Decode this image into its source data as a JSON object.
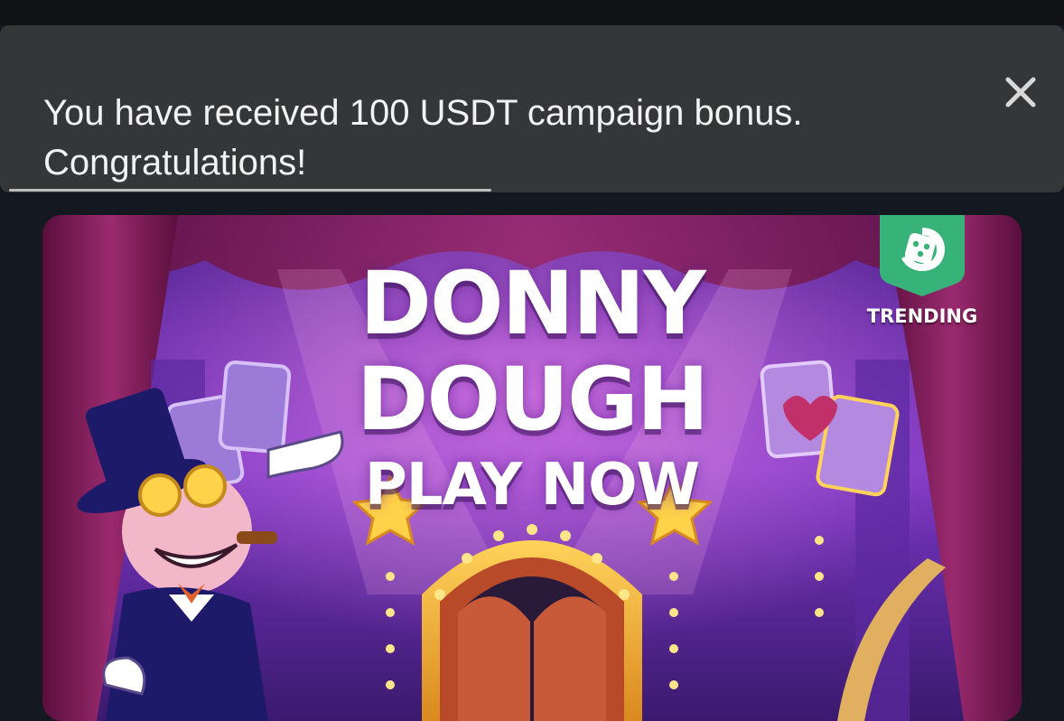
{
  "toast": {
    "line1": "You have received 100 USDT campaign bonus.",
    "line2": "Congratulations!",
    "close_icon": "close-icon",
    "progress": 0.46
  },
  "banner": {
    "title_line1": "DONNY",
    "title_line2": "DOUGH",
    "cta": "PLAY NOW",
    "badge_label": "TRENDING",
    "badge_icon": "dice-icon",
    "colors": {
      "background": "#6a2fb0",
      "curtain": "#7a1b5a",
      "stage_gold": "#f2b33a",
      "badge_green": "#37b37a"
    }
  }
}
